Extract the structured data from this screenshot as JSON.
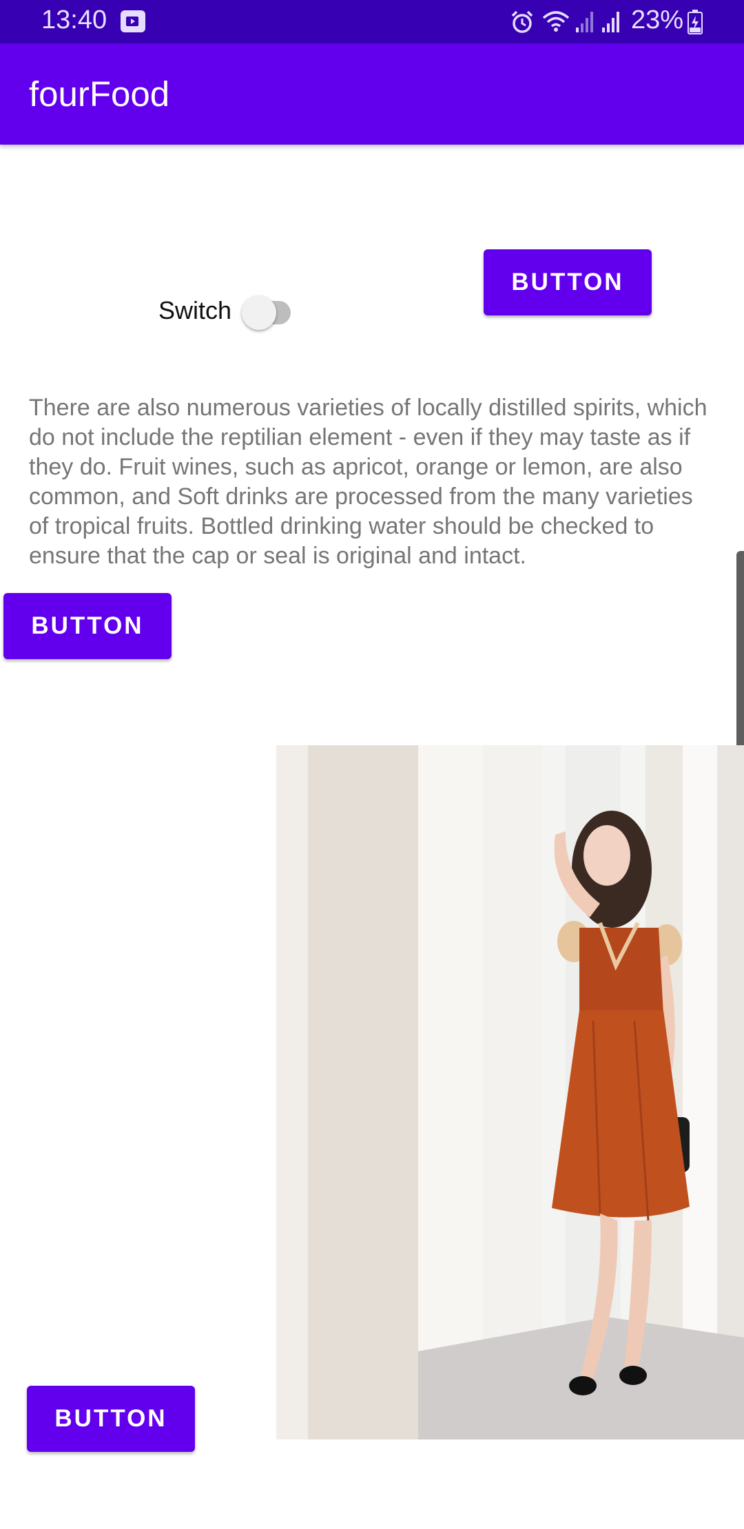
{
  "status_bar": {
    "time": "13:40",
    "battery_percent": "23%",
    "icons": [
      "media-icon",
      "alarm-icon",
      "wifi-icon",
      "signal-icon",
      "signal-icon",
      "battery-charging-icon"
    ]
  },
  "app_bar": {
    "title": "fourFood"
  },
  "top_button": {
    "label": "BUTTON"
  },
  "switch": {
    "label": "Switch",
    "checked": false
  },
  "paragraph": {
    "lines": [
      "There are also numerous varieties of locally distilled spirits, which",
      "do not include the reptilian element - even if they may taste as if",
      "they do. Fruit wines, such as apricot, orange or lemon, are also",
      "common, and Soft drinks are processed from the many varieties",
      "of tropical fruits. Bottled drinking water should be checked to",
      "ensure that the cap or seal is original and intact."
    ]
  },
  "middle_button": {
    "label": "BUTTON"
  },
  "bottom_button": {
    "label": "BUTTON"
  },
  "image": {
    "subject": "woman-in-orange-dress-photo"
  },
  "colors": {
    "status_bar": "#3700b3",
    "primary": "#6200ee",
    "on_primary": "#ffffff",
    "body_text": "#757575"
  }
}
